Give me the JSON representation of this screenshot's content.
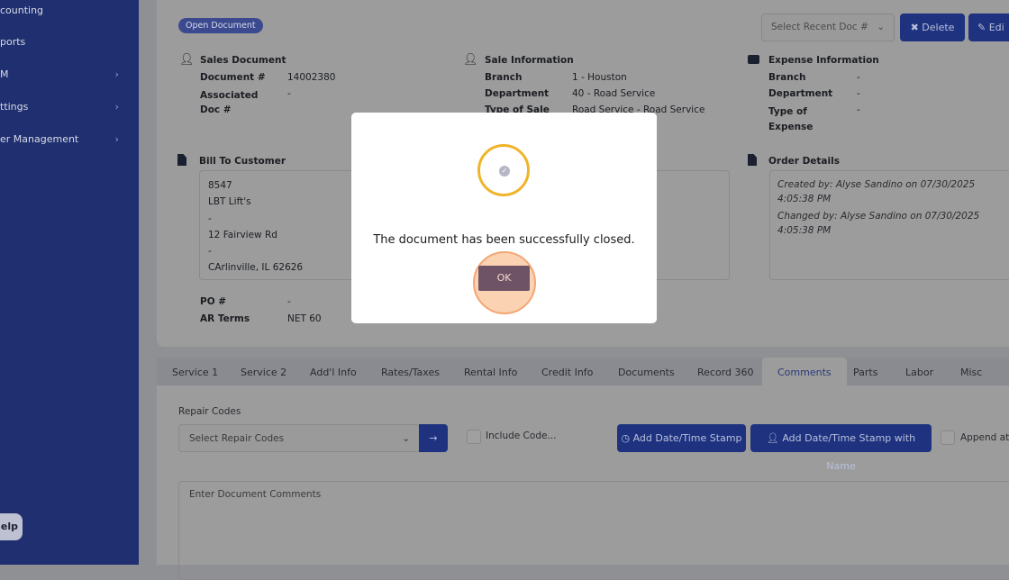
{
  "sidebar": {
    "items": [
      {
        "label": "counting"
      },
      {
        "label": "ports"
      },
      {
        "label": "M"
      },
      {
        "label": "ttings"
      },
      {
        "label": "er Management"
      }
    ],
    "help": "elp"
  },
  "header": {
    "status_pill": "Open Document",
    "recent_doc_placeholder": "Select Recent Doc #",
    "delete": "Delete",
    "edit": "Edi"
  },
  "sales": {
    "title": "Sales Document",
    "doc_label": "Document #",
    "doc_value": "14002380",
    "assoc_label": "Associated Doc #",
    "assoc_value": "-"
  },
  "sale_info": {
    "title": "Sale Information",
    "branch_label": "Branch",
    "branch_value": "1 - Houston",
    "dept_label": "Department",
    "dept_value": "40 - Road Service",
    "type_label": "Type of Sale",
    "type_value": "Road Service - Road Service"
  },
  "expense": {
    "title": "Expense Information",
    "branch_label": "Branch",
    "branch_value": "-",
    "dept_label": "Department",
    "dept_value": "-",
    "type_label": "Type of Expense",
    "type_value": "-"
  },
  "bill_to": {
    "title": "Bill To Customer",
    "lines": [
      "8547",
      "LBT Lift's",
      "-",
      "12 Fairview Rd",
      "-",
      "CArlinville, IL 62626"
    ],
    "po_label": "PO #",
    "po_value": "-",
    "terms_label": "AR Terms",
    "terms_value": "NET 60"
  },
  "order": {
    "title": "Order Details",
    "created": "Created by: Alyse Sandino on 07/30/2025 4:05:38 PM",
    "changed": "Changed by: Alyse Sandino on 07/30/2025 4:05:38 PM"
  },
  "tabs": [
    "Service 1",
    "Service 2",
    "Add'l Info",
    "Rates/Taxes",
    "Rental Info",
    "Credit Info",
    "Documents",
    "Record 360",
    "Comments",
    "Parts",
    "Labor",
    "Misc"
  ],
  "comments": {
    "repair_label": "Repair Codes",
    "repair_placeholder": "Select Repair Codes",
    "include_code": "Include Code...",
    "stamp": "Add Date/Time Stamp",
    "stamp_name": "Add Date/Time Stamp with Name",
    "append": "Append at T",
    "comments_placeholder": "Enter Document Comments"
  },
  "modal": {
    "message": "The document has been successfully closed.",
    "ok": "OK"
  },
  "colors": {
    "sidebar": "#1f2f6f",
    "primary_button": "#1e3280",
    "ring": "#f0b429",
    "ok_button": "#6e5266"
  }
}
